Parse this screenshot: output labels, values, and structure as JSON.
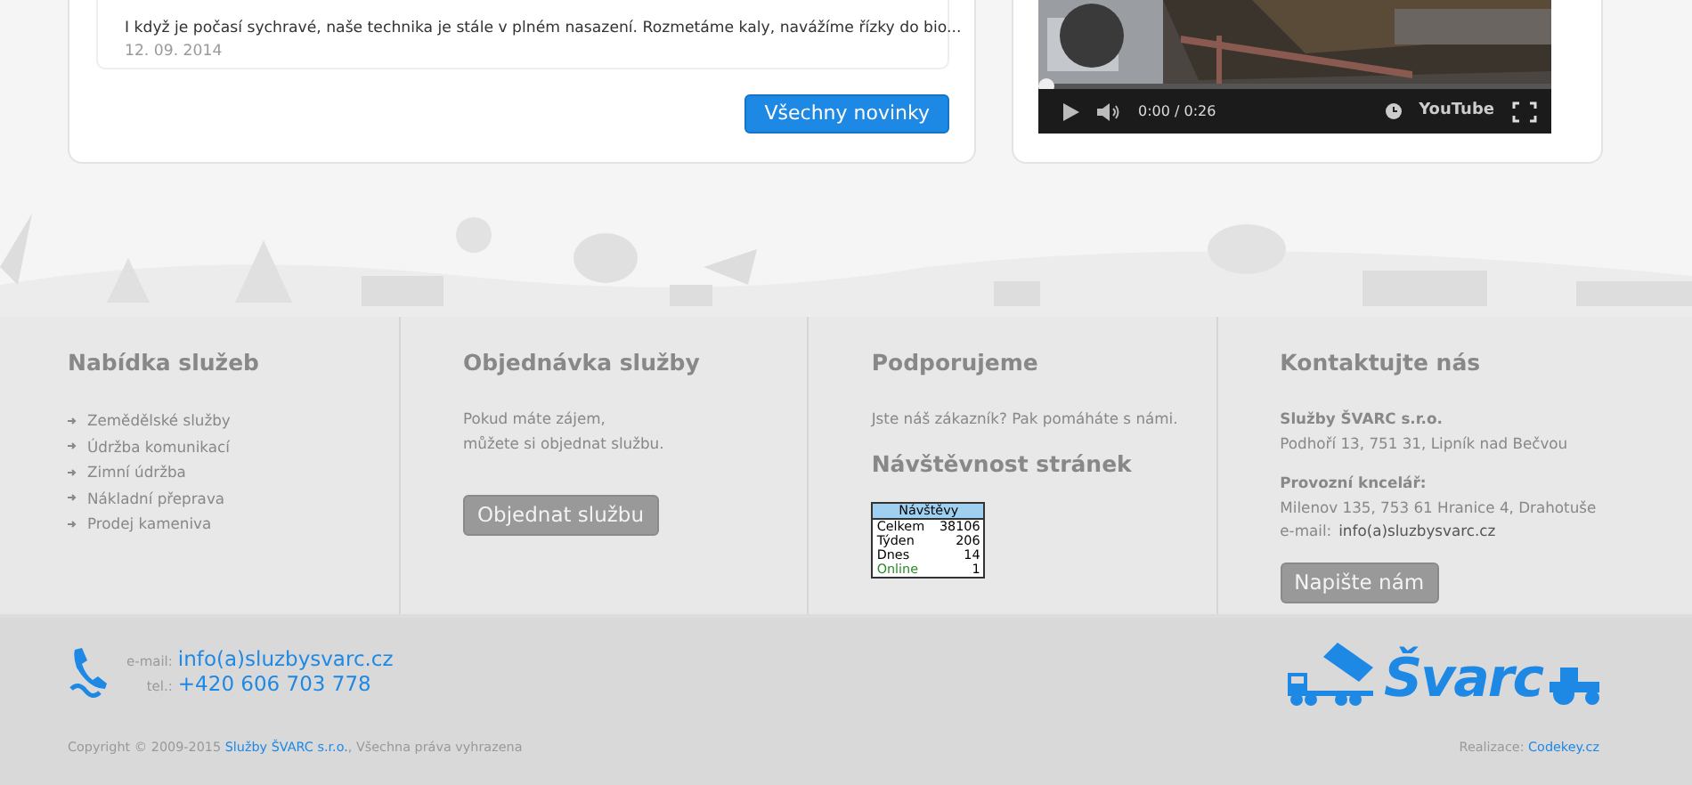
{
  "news": {
    "items": [
      {
        "excerpt": "I když je počasí sychravé, naše technika je stále v plném nasazení. Rozmetáme kaly, navážíme řízky do bio...",
        "date": "12. 09. 2014"
      }
    ],
    "button": "Všechny novinky"
  },
  "video": {
    "time": "0:00 / 0:26",
    "progress": {
      "level": 0
    },
    "brand": "YouTube"
  },
  "footer": {
    "columns": [
      {
        "kind": "links",
        "title": "Nabídka služeb",
        "links": [
          "Zemědělské služby",
          "Údržba komunikací",
          "Zimní údržba",
          "Nákladní přeprava",
          "Prodej kameniva"
        ]
      },
      {
        "kind": "order",
        "title": "Objednávka služby",
        "lines": [
          "Pokud máte zájem,",
          "můžete si objednat službu."
        ],
        "button": "Objednat službu"
      },
      {
        "kind": "support",
        "title": "Podporujeme",
        "text": "Jste náš zákazník? Pak pomáháte s námi.",
        "subtitle": "Návštěvnost stránek",
        "counter": {
          "header": "Návštěvy",
          "rows": [
            {
              "label": "Celkem",
              "value": "38106",
              "online": false
            },
            {
              "label": "Týden",
              "value": "206",
              "online": false
            },
            {
              "label": "Dnes",
              "value": "14",
              "online": false
            },
            {
              "label": "Online",
              "value": "1",
              "online": true
            }
          ]
        }
      },
      {
        "kind": "contact",
        "title": "Kontaktujte nás",
        "company": "Služby ŠVARC s.r.o.",
        "address": "Podhoří 13, 751 31, Lipník nad Bečvou",
        "office_label": "Provozní kncelář:",
        "office_address": "Milenov 135, 753 61 Hranice 4, Drahotuše",
        "email_label": "e-mail:",
        "email": "info(a)sluzbysvarc.cz",
        "button": "Napište nám"
      }
    ]
  },
  "bottom": {
    "email_label": "e-mail:",
    "email": "info(a)sluzbysvarc.cz",
    "tel_label": "tel.:",
    "tel": "+420 606 703 778",
    "copyright": "Copyright © 2009-2015",
    "company_link": "Služby ŠVARC s.r.o.",
    "rights": ", Všechna práva vyhrazena",
    "logo": "Švarc",
    "credit_label": "Realizace:",
    "credit_link": "Codekey.cz"
  }
}
